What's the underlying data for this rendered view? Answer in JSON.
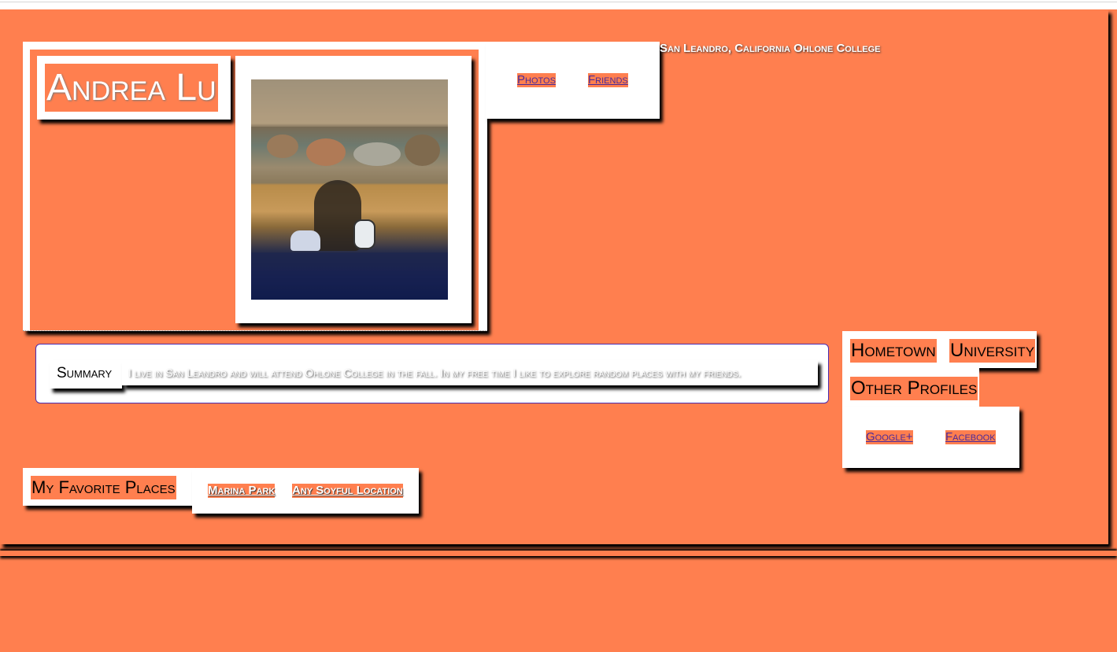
{
  "profile": {
    "name": "Andrea Lu",
    "location": "San Leandro, California Ohlone College"
  },
  "nav": {
    "photos": "Photos",
    "friends": "Friends"
  },
  "summary": {
    "label": "Summary",
    "text": "I live in San Leandro and will attend Ohlone College in the fall. In my free time I like to explore random places with my friends."
  },
  "info": {
    "hometown": "Hometown",
    "university": "University",
    "other_profiles": "Other Profiles",
    "google": "Google+",
    "facebook": "Facebook"
  },
  "favorites": {
    "title": "My Favorite Places",
    "places": [
      "Marina Park",
      "Any Soyful Location"
    ]
  },
  "colors": {
    "background": "#ff7f4f",
    "link": "#4a2a9a",
    "panel": "#ffffff"
  }
}
